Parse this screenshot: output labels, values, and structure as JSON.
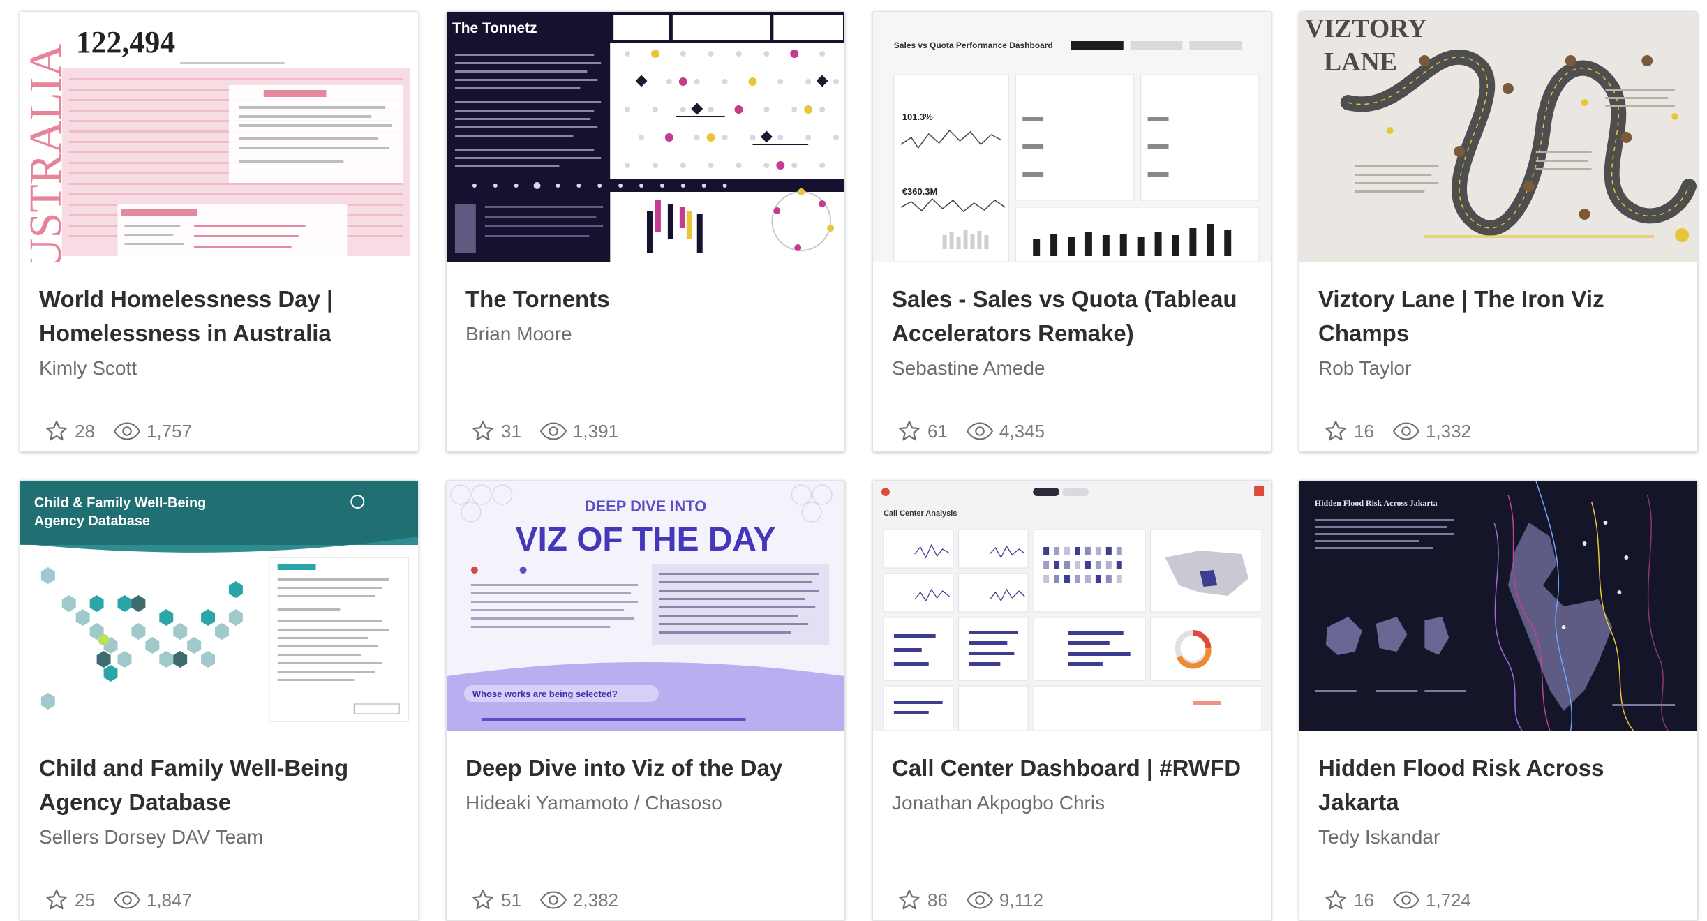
{
  "cards": [
    {
      "title": "World Homelessness Day | Homelessness in Australia",
      "author": "Kimly Scott",
      "favorites": "28",
      "views": "1,757",
      "thumb": {
        "bigNumber": "122,494",
        "sideWord": "USTRALIA",
        "bg": "#f7dde3"
      }
    },
    {
      "title": "The Tornents",
      "author": "Brian Moore",
      "favorites": "31",
      "views": "1,391",
      "thumb": {
        "header": "The Tonnetz",
        "bg": "#16112e"
      }
    },
    {
      "title": "Sales - Sales vs Quota (Tableau Accelerators Remake)",
      "author": "Sebastine Amede",
      "favorites": "61",
      "views": "4,345",
      "thumb": {
        "header": "Sales vs Quota Performance Dashboard",
        "kpi1": "101.3%",
        "kpi2": "€360.3M",
        "bg": "#f6f6f6"
      }
    },
    {
      "title": "Viztory Lane | The Iron Viz Champs",
      "author": "Rob Taylor",
      "favorites": "16",
      "views": "1,332",
      "thumb": {
        "header1": "VIZTORY",
        "header2": "LANE",
        "bg": "#eae7e2"
      }
    },
    {
      "title": "Child and Family Well-Being Agency Database",
      "author": "Sellers Dorsey DAV Team",
      "favorites": "25",
      "views": "1,847",
      "thumb": {
        "header1": "Child & Family Well-Being",
        "header2": "Agency Database",
        "bg": "#1f6f73"
      }
    },
    {
      "title": "Deep Dive into Viz of the Day",
      "author": "Hideaki Yamamoto / Chasoso",
      "favorites": "51",
      "views": "2,382",
      "thumb": {
        "header1": "DEEP DIVE INTO",
        "header2": "VIZ OF THE DAY",
        "question": "Whose works are being selected?",
        "bg": "#f4f2fb"
      }
    },
    {
      "title": "Call Center Dashboard | #RWFD",
      "author": "Jonathan Akpogbo Chris",
      "favorites": "86",
      "views": "9,112",
      "thumb": {
        "header": "Call Center Analysis",
        "bg": "#f3f3f5"
      }
    },
    {
      "title": "Hidden Flood Risk Across Jakarta",
      "author": "Tedy Iskandar",
      "favorites": "16",
      "views": "1,724",
      "thumb": {
        "header": "Hidden Flood Risk Across Jakarta",
        "bg": "#15152a"
      }
    }
  ],
  "icons": {
    "favorite": "star-outline-icon",
    "views": "eye-icon"
  },
  "colors": {
    "title": "#2e2e2e",
    "author": "#6d6d6d",
    "stat": "#7a7a7a"
  }
}
